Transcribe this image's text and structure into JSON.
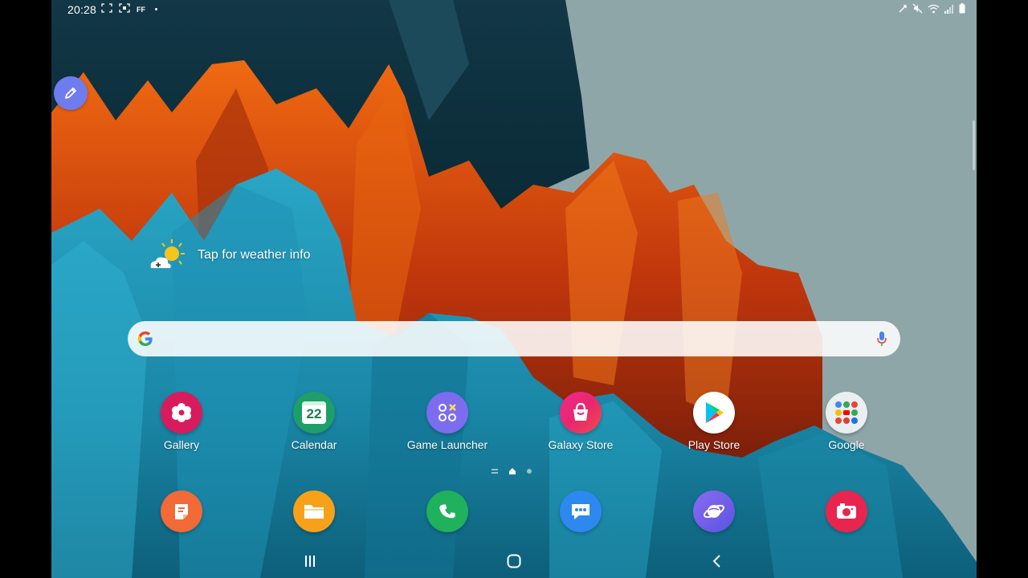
{
  "status_bar": {
    "time": "20:28",
    "left_icons": [
      "screenshot-icon",
      "screen-recorder-icon",
      "ff-icon",
      "notification-dot-icon"
    ],
    "ff_label": "FF",
    "right_icons": [
      "nfc-icon",
      "mute-icon",
      "wifi-icon",
      "signal-icon",
      "battery-icon"
    ]
  },
  "weather": {
    "label": "Tap for weather info",
    "icon": "weather-sun-cloud-icon"
  },
  "search": {
    "placeholder": ""
  },
  "apps": [
    {
      "label": "Gallery",
      "icon": "gallery-icon",
      "color": "#d81b5d"
    },
    {
      "label": "Calendar",
      "icon": "calendar-icon",
      "color": "#1e9e6a",
      "day": "22"
    },
    {
      "label": "Game Launcher",
      "icon": "game-launcher-icon",
      "color": "#7b6cf0"
    },
    {
      "label": "Galaxy Store",
      "icon": "galaxy-store-icon",
      "color": "#e8276f"
    },
    {
      "label": "Play Store",
      "icon": "play-store-icon",
      "color": "#ffffff"
    },
    {
      "label": "Google",
      "icon": "google-folder-icon",
      "color": "#e9eef0"
    }
  ],
  "dock": [
    {
      "icon": "samsung-notes-icon",
      "color": "#f26a35"
    },
    {
      "icon": "my-files-icon",
      "color": "#f7a11a"
    },
    {
      "icon": "phone-icon",
      "color": "#1fb15c"
    },
    {
      "icon": "messages-icon",
      "color": "#2d88f0"
    },
    {
      "icon": "samsung-internet-icon",
      "color": "#6e60e6"
    },
    {
      "icon": "camera-icon",
      "color": "#e8254e"
    }
  ],
  "page_indicator": {
    "pages": 2,
    "current": 1
  },
  "nav_bar": {
    "buttons": [
      "recents-icon",
      "home-icon",
      "back-icon"
    ]
  }
}
